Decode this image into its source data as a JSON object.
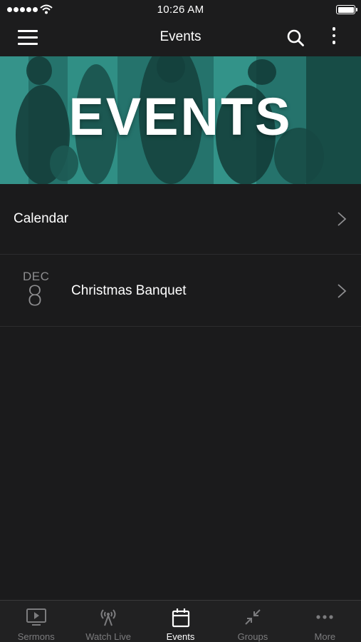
{
  "status_bar": {
    "time": "10:26 AM"
  },
  "nav": {
    "title": "Events"
  },
  "hero": {
    "title": "EVENTS"
  },
  "list": {
    "calendar_label": "Calendar",
    "events": [
      {
        "month": "DEC",
        "day": "8",
        "title": "Christmas Banquet"
      }
    ]
  },
  "tabs": [
    {
      "label": "Sermons",
      "icon": "play-screen-icon",
      "active": false
    },
    {
      "label": "Watch Live",
      "icon": "broadcast-antenna-icon",
      "active": false
    },
    {
      "label": "Events",
      "icon": "calendar-icon",
      "active": true
    },
    {
      "label": "Groups",
      "icon": "arrows-inward-icon",
      "active": false
    },
    {
      "label": "More",
      "icon": "ellipsis-icon",
      "active": false
    }
  ],
  "colors": {
    "background": "#1b1b1c",
    "hero_tint": "#2f8f86",
    "muted_text": "#8e8e90",
    "inactive_tab": "#7c7c7e"
  }
}
